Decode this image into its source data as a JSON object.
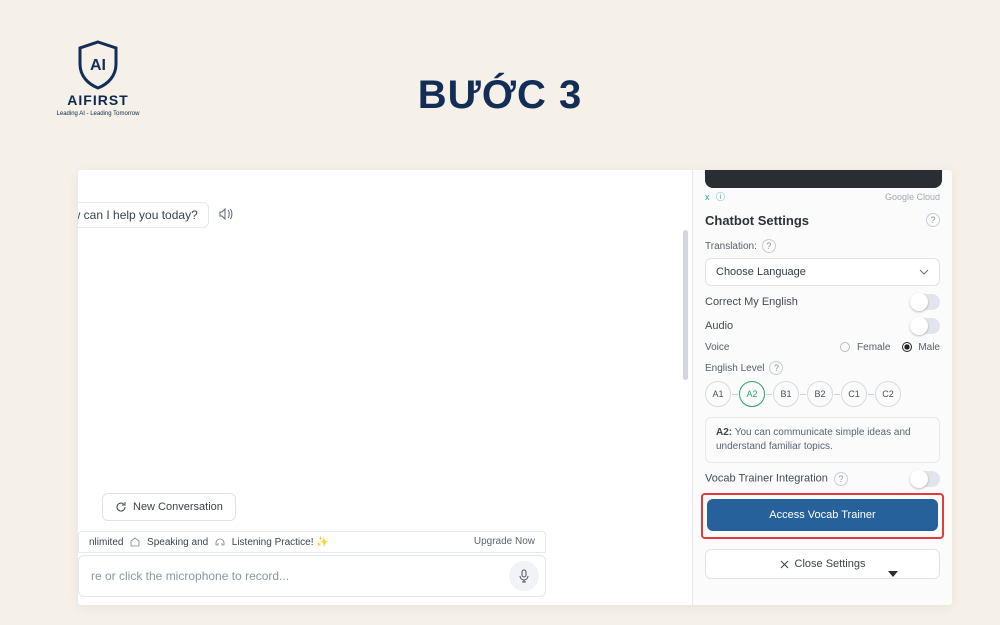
{
  "page": {
    "title": "BƯỚC 3",
    "brand": "AIFIRST",
    "tagline": "Leading AI - Leading Tomorrow",
    "logo_text": "AI"
  },
  "chat": {
    "assistant_line": "ow can I help you today?",
    "new_conversation": "New Conversation",
    "input_placeholder": "re or click the microphone to record...",
    "upgrade_prefix": "nlimited",
    "speaking": "Speaking",
    "and": "and",
    "listening": "Listening Practice!",
    "upgrade_cta": "Upgrade Now"
  },
  "settings": {
    "ad_close": "x",
    "ad_info": "ⓘ",
    "ad_right": "Google Cloud",
    "title": "Chatbot Settings",
    "translation_label": "Translation:",
    "language_placeholder": "Choose Language",
    "correct_label": "Correct My English",
    "audio_label": "Audio",
    "voice_label": "Voice",
    "voice_female": "Female",
    "voice_male": "Male",
    "voice_selected": "Male",
    "english_level_label": "English Level",
    "levels": [
      "A1",
      "A2",
      "B1",
      "B2",
      "C1",
      "C2"
    ],
    "selected_level": "A2",
    "level_code": "A2:",
    "level_desc": "You can communicate simple ideas and understand familiar topics.",
    "vocab_label": "Vocab Trainer Integration",
    "access_btn": "Access Vocab Trainer",
    "close_btn": "Close Settings"
  }
}
